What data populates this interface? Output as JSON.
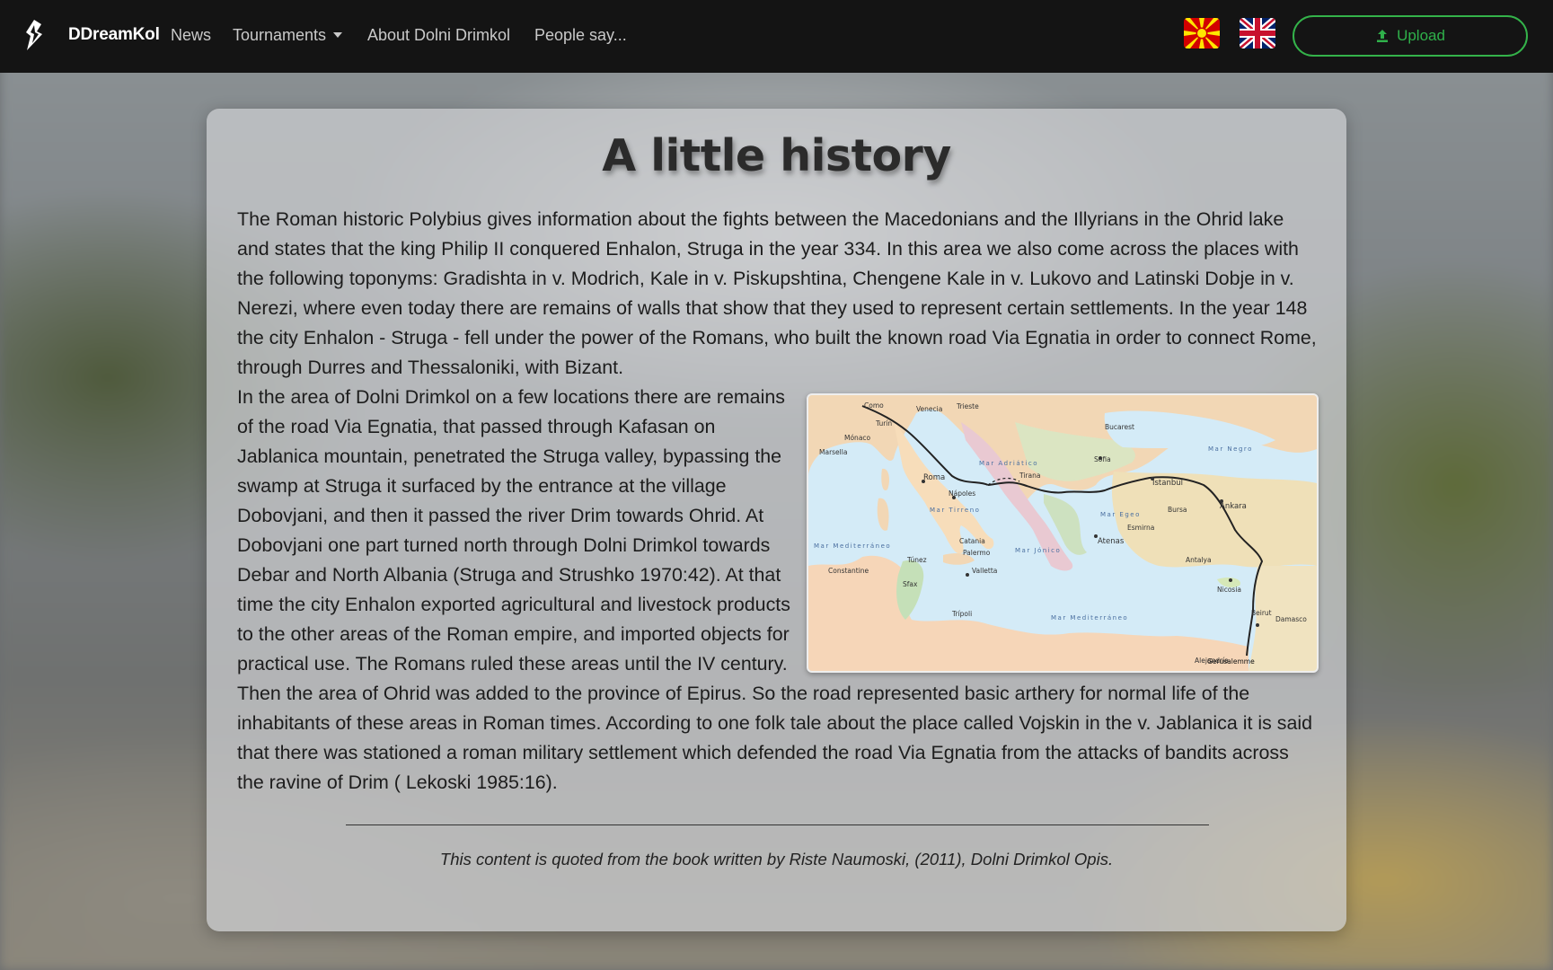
{
  "nav": {
    "brand": "DDreamKol",
    "links": [
      {
        "label": "News"
      },
      {
        "label": "Tournaments"
      },
      {
        "label": "About Dolni Drimkol"
      },
      {
        "label": "People say..."
      }
    ],
    "upload_label": "Upload",
    "icons": {
      "brand": "flame-logo-icon",
      "flag_mk": "macedonia-flag-icon",
      "flag_en": "uk-flag-icon",
      "upload": "upload-icon"
    }
  },
  "article": {
    "title": "A little history",
    "paragraph1": "The Roman historic Polybius gives information about the fights between the Macedonians and the Illyrians in the Ohrid lake and states that the king Philip II conquered Enhalon, Struga in the year 334. In this area we also come across the places with the following toponyms: Gradishta in v. Modrich, Kale in v. Piskupshtina, Chengene Kale in v. Lukovo and Latinski Dobje in v. Nerezi, where even today there are remains of walls that show that they used to represent certain settlements. In the year 148 the city Enhalon - Struga - fell under the power of the Romans, who built the known road Via Egnatia in order to connect Rome, through Durres and Thessaloniki, with Bizant.",
    "paragraph2": "In the area of Dolni Drimkol on a few locations there are remains of the road Via Egnatia, that passed through Kafasan on Jablanica mountain, penetrated the Struga valley, bypassing the swamp at Struga it surfaced by the entrance at the village Dobovjani, and then it passed the river Drim towards Ohrid. At Dobovjani one part turned north through Dolni Drimkol towards Debar and North Albania (Struga and Strushko 1970:42). At that time the city Enhalon exported agricultural and livestock products to the other areas of the Roman empire, and imported objects for practical use. The Romans ruled these areas until the IV century. Then the area of Ohrid was added to the province of Epirus. So the road represented basic arthery for normal life of the inhabitants of these areas in Roman times. According to one folk tale about the place called Vojskin in the v. Jablanica it is said that there was stationed a roman military settlement which defended the road Via Egnatia from the attacks of bandits across the ravine of Drim ( Lekoski 1985:16).",
    "quote": "This content is quoted from the book written by Riste Naumoski, (2011), Dolni Drimkol Opis."
  },
  "map": {
    "labels": {
      "sea1": "Mar Mediterráneo",
      "sea2": "Mar Mediterráneo",
      "sea3": "Mar Negro",
      "sea4": "Mar Tirreno",
      "sea5": "Mar Jónico",
      "sea6": "Mar Adriático",
      "sea7": "Mar Egeo",
      "city_roma": "Roma",
      "city_istanbul": "Istanbul",
      "city_ankara": "Ankara",
      "city_atenas": "Atenas",
      "city_sofia": "Sofia",
      "city_como": "Como",
      "city_monaco": "Mónaco",
      "city_gerusalemme": "Gerusalemme",
      "city_napoles": "Nápoles",
      "city_trieste": "Trieste",
      "city_bucarest": "Bucarest",
      "city_tirana": "Tirana",
      "city_tripoli": "Trípoli",
      "city_alejandria": "Alejandría",
      "city_marsella": "Marsella",
      "city_turin": "Turín",
      "city_venecia": "Venecia",
      "city_beirut": "Beirut",
      "city_damasco": "Damasco",
      "city_nicosia": "Nicosia",
      "city_constantine": "Constantine",
      "city_valletta": "Valletta",
      "city_esmirna": "Esmirna",
      "city_catania": "Catania",
      "city_palermo": "Palermo",
      "city_tunez": "Túnez",
      "city_sfax": "Sfax",
      "city_antalya": "Antalya",
      "city_bursa": "Bursa"
    }
  }
}
